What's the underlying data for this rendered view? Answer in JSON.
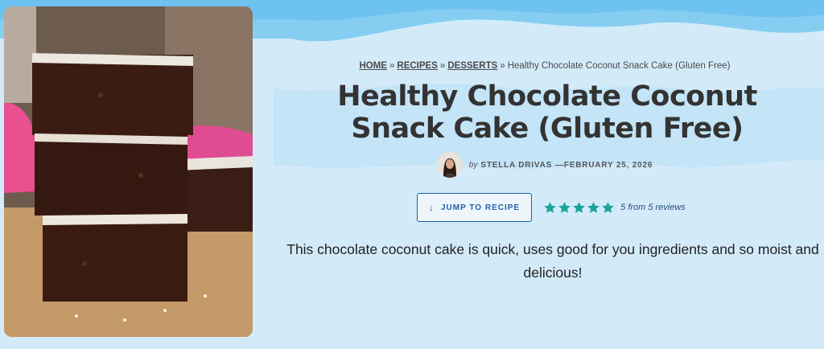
{
  "breadcrumb": {
    "items": [
      "HOME",
      "RECIPES",
      "DESSERTS"
    ],
    "separator": "»",
    "current": "Healthy Chocolate Coconut Snack Cake (Gluten Free)"
  },
  "post": {
    "title": "Healthy Chocolate Coconut Snack Cake (Gluten Free)",
    "by": "by",
    "author": "STELLA DRIVAS",
    "date_prefix": "—",
    "date": "FEBRUARY 25, 2026",
    "summary": "This chocolate coconut cake is quick, uses good for you ingredients and so moist and delicious!"
  },
  "actions": {
    "jump_label": "JUMP TO RECIPE",
    "jump_icon": "arrow-down-icon"
  },
  "rating": {
    "stars": 5,
    "max": 5,
    "text": "5 from 5 reviews",
    "star_color": "#1aa39a"
  },
  "colors": {
    "background": "#cfe9f8",
    "accent": "#1f5fa8"
  }
}
